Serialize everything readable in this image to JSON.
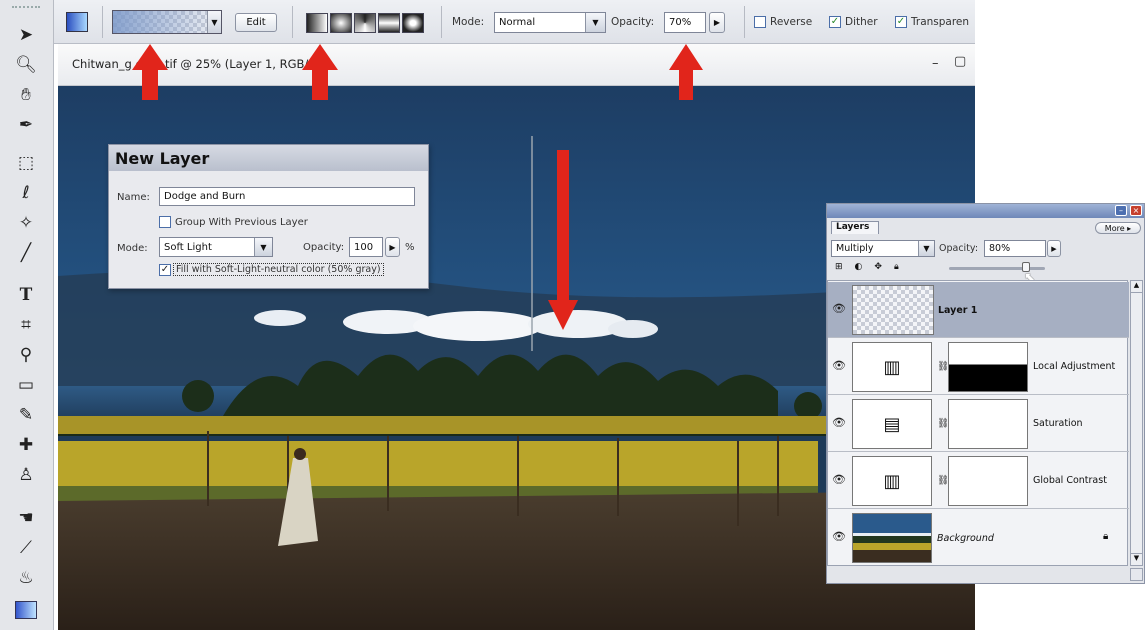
{
  "toolbox": {
    "tools": [
      "move-icon",
      "zoom-icon",
      "hand-icon",
      "eyedropper-icon",
      "marquee-icon",
      "lasso-icon",
      "magic-wand-icon",
      "brush-icon",
      "type-icon",
      "crop-icon",
      "stamp-icon",
      "eraser-icon",
      "pen-icon",
      "healing-icon",
      "paint-bucket-icon",
      "smudge-icon",
      "dodge-icon",
      "fill-icon",
      "gradient-icon"
    ]
  },
  "options_bar": {
    "edit_label": "Edit",
    "mode_label": "Mode:",
    "mode_value": "Normal",
    "opacity_label": "Opacity:",
    "opacity_value": "70%",
    "reverse_label": "Reverse",
    "dither_label": "Dither",
    "transparency_label": "Transparen",
    "reverse_checked": false,
    "dither_checked": true,
    "transparency_checked": true
  },
  "document": {
    "title": "Chitwan_g ed-3.tif @ 25% (Layer 1, RGB/8)",
    "minimize": "–",
    "maximize": "▢"
  },
  "new_layer_dialog": {
    "title": "New Layer",
    "name_label": "Name:",
    "name_value": "Dodge and Burn",
    "group_label": "Group With Previous Layer",
    "mode_label": "Mode:",
    "mode_value": "Soft Light",
    "opacity_label": "Opacity:",
    "opacity_value": "100",
    "percent": "%",
    "fill_label": "Fill with Soft-Light-neutral color (50% gray)",
    "fill_checked": true
  },
  "layers_panel": {
    "tab": "Layers",
    "more_label": "More ▸",
    "blend_mode": "Multiply",
    "opacity_label": "Opacity:",
    "opacity_value": "80%",
    "slider_level": 0.8,
    "layers": [
      {
        "name": "Layer 1",
        "selected": true
      },
      {
        "name": "Local Adjustment"
      },
      {
        "name": "Saturation"
      },
      {
        "name": "Global Contrast"
      },
      {
        "name": "Background",
        "locked": true
      }
    ]
  },
  "colors": {
    "accent_arrow": "#e1251b",
    "sky_top": "#1d3d63",
    "field_yellow": "#b9a52a",
    "selected_layer": "#a6afc2"
  }
}
